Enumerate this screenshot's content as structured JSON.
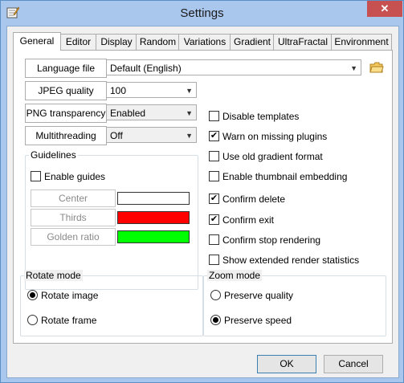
{
  "window": {
    "title": "Settings",
    "close_glyph": "✕"
  },
  "tabs": [
    "General",
    "Editor",
    "Display",
    "Random",
    "Variations",
    "Gradient",
    "UltraFractal",
    "Environment"
  ],
  "fields": {
    "language": {
      "label": "Language file",
      "value": "Default (English)"
    },
    "jpeg": {
      "label": "JPEG quality",
      "value": "100"
    },
    "png": {
      "label": "PNG transparency",
      "value": "Enabled"
    },
    "threads": {
      "label": "Multithreading",
      "value": "Off"
    }
  },
  "guidelines": {
    "title": "Guidelines",
    "enable_guides": "Enable guides",
    "rows": [
      {
        "label": "Center",
        "color": "#ffffff"
      },
      {
        "label": "Thirds",
        "color": "#ff0000"
      },
      {
        "label": "Golden ratio",
        "color": "#00ff00"
      }
    ]
  },
  "options": [
    {
      "label": "Disable templates",
      "checked": false
    },
    {
      "label": "Warn on missing plugins",
      "checked": true
    },
    {
      "label": "Use old gradient format",
      "checked": false
    },
    {
      "label": "Enable thumbnail embedding",
      "checked": false
    },
    {
      "label": "Confirm delete",
      "checked": true
    },
    {
      "label": "Confirm exit",
      "checked": true
    },
    {
      "label": "Confirm stop rendering",
      "checked": false
    },
    {
      "label": "Show extended render statistics",
      "checked": false
    }
  ],
  "rotate_mode": {
    "title": "Rotate mode",
    "options": [
      "Rotate image",
      "Rotate frame"
    ],
    "selected": 0
  },
  "zoom_mode": {
    "title": "Zoom mode",
    "options": [
      "Preserve quality",
      "Preserve speed"
    ],
    "selected": 1
  },
  "buttons": {
    "ok": "OK",
    "cancel": "Cancel"
  },
  "icons": {
    "app": "settings-app-icon",
    "folder": "folder-icon",
    "arrow": "chevron-down-icon",
    "check": "✔"
  }
}
